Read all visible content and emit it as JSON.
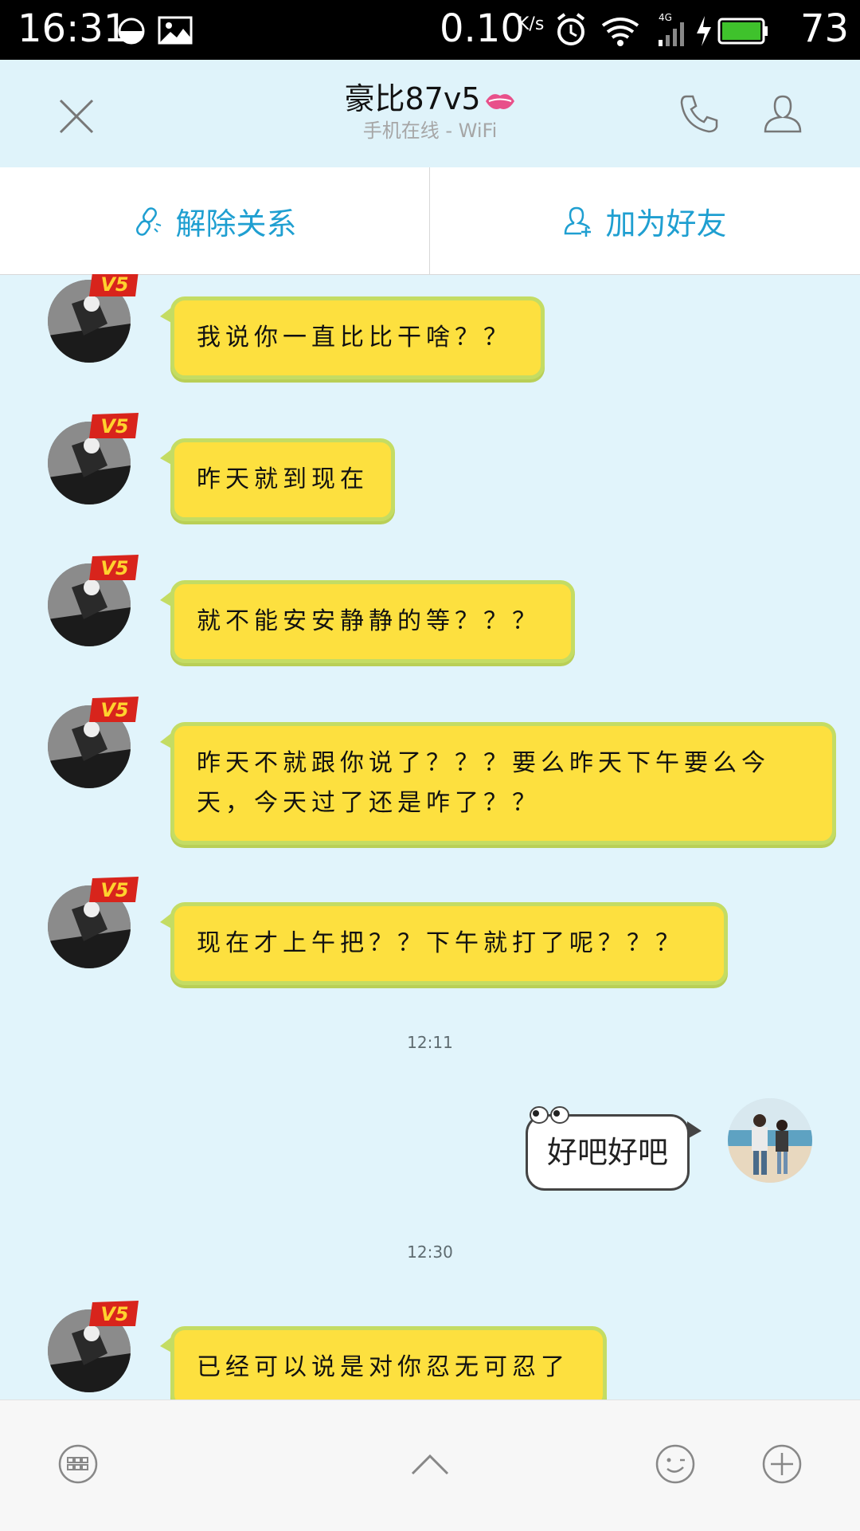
{
  "status_bar": {
    "time": "16:31",
    "speed": "0.10",
    "speed_unit": "K/s",
    "network": "4G",
    "battery": "73",
    "icons": [
      "moon-icon",
      "image-icon",
      "alarm-icon",
      "wifi-icon",
      "signal-icon",
      "charging-icon",
      "battery-icon"
    ]
  },
  "header": {
    "title": "豪比87v5",
    "subtitle": "手机在线 - WiFi",
    "icons": [
      "close-icon",
      "kiss-icon",
      "phone-icon",
      "profile-icon"
    ]
  },
  "actions": {
    "unlink_label": "解除关系",
    "add_friend_label": "加为好友"
  },
  "badge_text": "V5",
  "messages": [
    {
      "from": "them",
      "text": "我说你一直比比干啥？？"
    },
    {
      "from": "them",
      "text": "昨天就到现在"
    },
    {
      "from": "them",
      "text": "就不能安安静静的等？？？"
    },
    {
      "from": "them",
      "text": "昨天不就跟你说了？？？要么昨天下午要么今天，今天过了还是咋了？？"
    },
    {
      "from": "them",
      "text": "现在才上午把？？下午就打了呢？？？"
    },
    {
      "time": "12:11"
    },
    {
      "from": "me",
      "text": "好吧好吧"
    },
    {
      "time": "12:30"
    },
    {
      "from": "them",
      "text": "已经可以说是对你忍无可忍了"
    }
  ],
  "bottom_bar": {
    "icons": [
      "keyboard-icon",
      "expand-up-icon",
      "emoji-icon",
      "plus-icon"
    ]
  },
  "colors": {
    "chat_bg": "#e1f4fb",
    "bubble_yellow": "#fde03f",
    "bubble_border": "#c4dc63",
    "accent": "#1f9fd1"
  }
}
